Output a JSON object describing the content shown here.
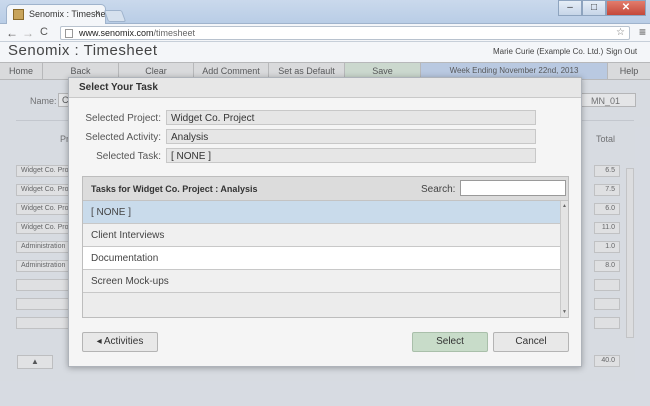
{
  "browser": {
    "tab_title": "Senomix : Timesheet",
    "tab_close": "×",
    "url_host": "www.senomix.com",
    "url_path": "/timesheet",
    "win_min": "–",
    "win_max": "□",
    "win_close": "✕",
    "icons": [
      "back-icon",
      "forward-icon",
      "reload-icon",
      "star-icon",
      "menu-icon"
    ],
    "back_glyph": "←",
    "forward_glyph": "→",
    "reload_glyph": "C",
    "star_glyph": "☆",
    "menu_glyph": "≡"
  },
  "app": {
    "title": "Senomix : Timesheet",
    "user": "Marie Curie  (Example Co. Ltd.)",
    "sign_out": "Sign Out"
  },
  "navbar": {
    "home": "Home",
    "back": "Back",
    "clear": "Clear",
    "add_comment": "Add Comment",
    "set_default": "Set as Default",
    "save": "Save",
    "week": "Week Ending November 22nd, 2013",
    "help": "Help",
    "colors": {
      "save_bg": "#cfdfcf",
      "week_bg": "#b7cbe8"
    }
  },
  "background": {
    "name_label": "Name:",
    "name_field": "C",
    "right_field": "MN_01",
    "project_header": "Pr",
    "total_header": "Total",
    "rows": [
      {
        "project": "Widget Co. Project",
        "total": "6.5"
      },
      {
        "project": "Widget Co. Project",
        "total": "7.5"
      },
      {
        "project": "Widget Co. Project",
        "total": "6.0"
      },
      {
        "project": "Widget Co. Project",
        "total": "11.0"
      },
      {
        "project": "Administration",
        "total": "1.0"
      },
      {
        "project": "Administration",
        "total": "8.0"
      }
    ],
    "grand_total": "40.0",
    "up_arrow": "▲"
  },
  "modal": {
    "title": "Select Your Task",
    "selected_project_label": "Selected Project:",
    "selected_project": "Widget Co. Project",
    "selected_activity_label": "Selected Activity:",
    "selected_activity": "Analysis",
    "selected_task_label": "Selected Task:",
    "selected_task": "[ NONE ]",
    "tasks_header": "Tasks for Widget Co. Project : Analysis",
    "search_label": "Search:",
    "search_value": "",
    "tasks": [
      "[ NONE ]",
      "Client Interviews",
      "Documentation",
      "Screen Mock-ups"
    ],
    "selected_index": 0,
    "activities_button": "◂ Activities",
    "select_button": "Select",
    "cancel_button": "Cancel",
    "colors": {
      "selected_row": "#c9dbeb",
      "select_button_bg": "#c8dcc9"
    }
  }
}
